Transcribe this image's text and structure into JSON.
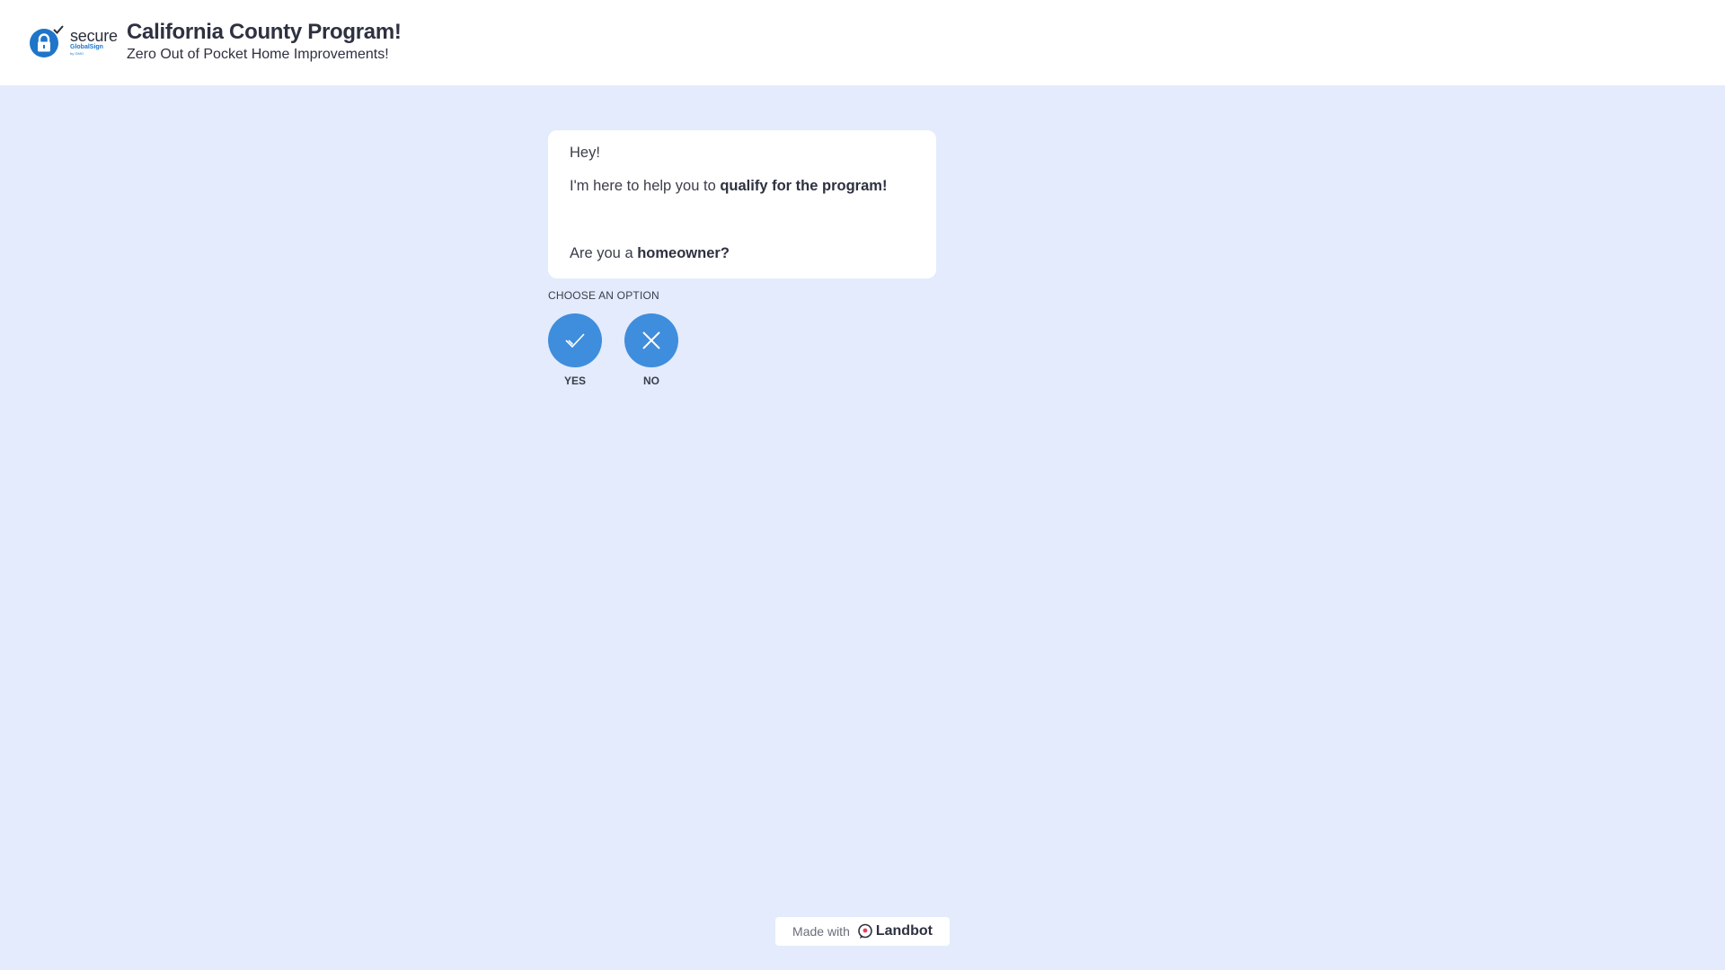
{
  "header": {
    "logo": {
      "secure_text": "secure",
      "brand_text": "GlobalSign",
      "sub_text": "by GMO"
    },
    "title": "California County Program!",
    "subtitle": "Zero Out of Pocket Home Improvements!"
  },
  "chat": {
    "message": {
      "greeting": "Hey!",
      "intro_prefix": "I'm here to help you to ",
      "intro_bold": "qualify for the program!",
      "question_prefix": "Are you a ",
      "question_bold": "homeowner?"
    },
    "choose_label": "CHOOSE AN OPTION",
    "options": [
      {
        "label": "YES",
        "icon": "check-icon"
      },
      {
        "label": "NO",
        "icon": "close-icon"
      }
    ]
  },
  "footer": {
    "made_with": "Made with",
    "brand": "Landbot"
  },
  "colors": {
    "background": "#e3ebfc",
    "option_button": "#3f8ddd",
    "brand_blue": "#1f75c9"
  }
}
